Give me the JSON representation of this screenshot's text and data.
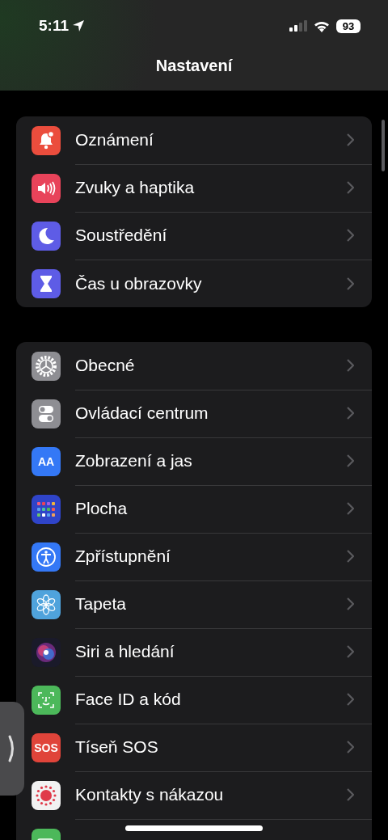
{
  "status_bar": {
    "time": "5:11",
    "battery": "93"
  },
  "title": "Nastavení",
  "groups": [
    {
      "items": [
        {
          "kind": "bell",
          "label": "Oznámení"
        },
        {
          "kind": "speaker",
          "label": "Zvuky a haptika"
        },
        {
          "kind": "moon",
          "label": "Soustředění"
        },
        {
          "kind": "hourglass",
          "label": "Čas u obrazovky"
        }
      ]
    },
    {
      "items": [
        {
          "kind": "gear",
          "label": "Obecné"
        },
        {
          "kind": "toggles",
          "label": "Ovládací centrum"
        },
        {
          "kind": "display",
          "icon_text": "AA",
          "label": "Zobrazení a jas"
        },
        {
          "kind": "grid",
          "label": "Plocha"
        },
        {
          "kind": "accessibility",
          "label": "Zpřístupnění"
        },
        {
          "kind": "flower",
          "label": "Tapeta"
        },
        {
          "kind": "orb",
          "label": "Siri a hledání"
        },
        {
          "kind": "face",
          "label": "Face ID a kód"
        },
        {
          "kind": "sos",
          "icon_text": "SOS",
          "label": "Tíseň SOS"
        },
        {
          "kind": "dots",
          "label": "Kontakty s nákazou"
        },
        {
          "kind": "battery"
        }
      ]
    }
  ]
}
